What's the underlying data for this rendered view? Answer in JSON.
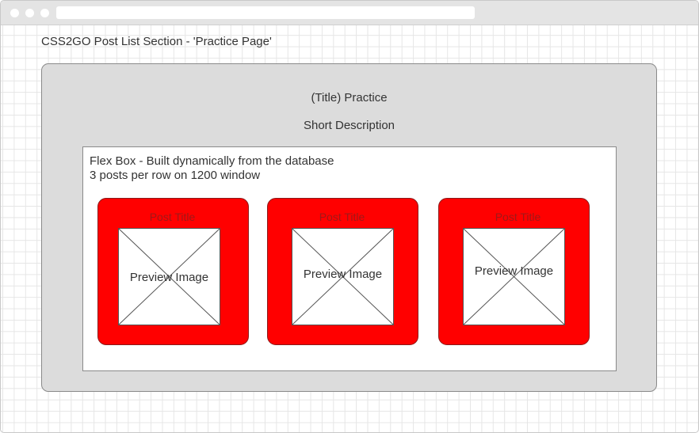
{
  "page": {
    "caption": "CSS2GO Post List Section - 'Practice Page'"
  },
  "section": {
    "title": "(Title) Practice",
    "description": "Short Description",
    "background_color": "#dcdcdc"
  },
  "flex_box": {
    "line1": "Flex Box - Built dynamically from the database",
    "line2": "3 posts per row on 1200 window"
  },
  "posts": [
    {
      "title": "Post Title",
      "image_label": "Preview Image"
    },
    {
      "title": "Post Title",
      "image_label": "Preview Image"
    },
    {
      "title": "Post Title",
      "image_label": "Preview Image"
    }
  ],
  "colors": {
    "post_card": "#ff0000",
    "post_title_text": "#a01818",
    "grid_lines": "#e6e6e6"
  },
  "icons": {
    "image_placeholder": "crossed-box"
  }
}
